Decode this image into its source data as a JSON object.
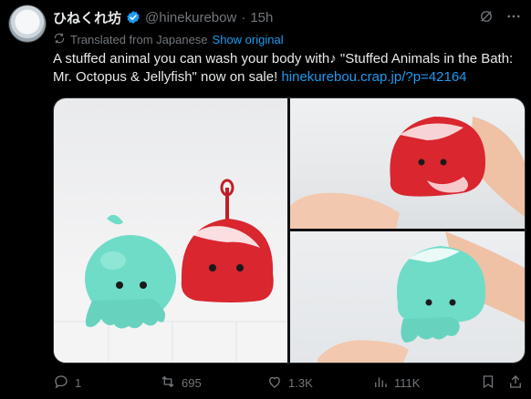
{
  "tweet": {
    "display_name": "ひねくれ坊",
    "handle": "@hinekurebow",
    "separator": "·",
    "time": "15h",
    "translation_note": "Translated from Japanese",
    "show_original": "Show original",
    "text": "A stuffed animal you can wash your body with♪ \"Stuffed Animals in the Bath: Mr. Octopus & Jellyfish\" now on sale! ",
    "link": "hinekurebou.crap.jp/?p=42164"
  },
  "actions": {
    "replies": "1",
    "reposts": "695",
    "likes": "1.3K",
    "views": "111K"
  },
  "colors": {
    "background": "#000000",
    "text": "#e7e9ea",
    "muted": "#71767b",
    "link": "#1d9bf0",
    "octopus_red": "#d9262f",
    "jellyfish_mint": "#6fdcc8"
  },
  "icons": [
    "verified-badge-icon",
    "grok-icon",
    "more-icon",
    "translate-icon",
    "reply-icon",
    "repost-icon",
    "like-icon",
    "views-icon",
    "bookmark-icon",
    "share-icon"
  ]
}
